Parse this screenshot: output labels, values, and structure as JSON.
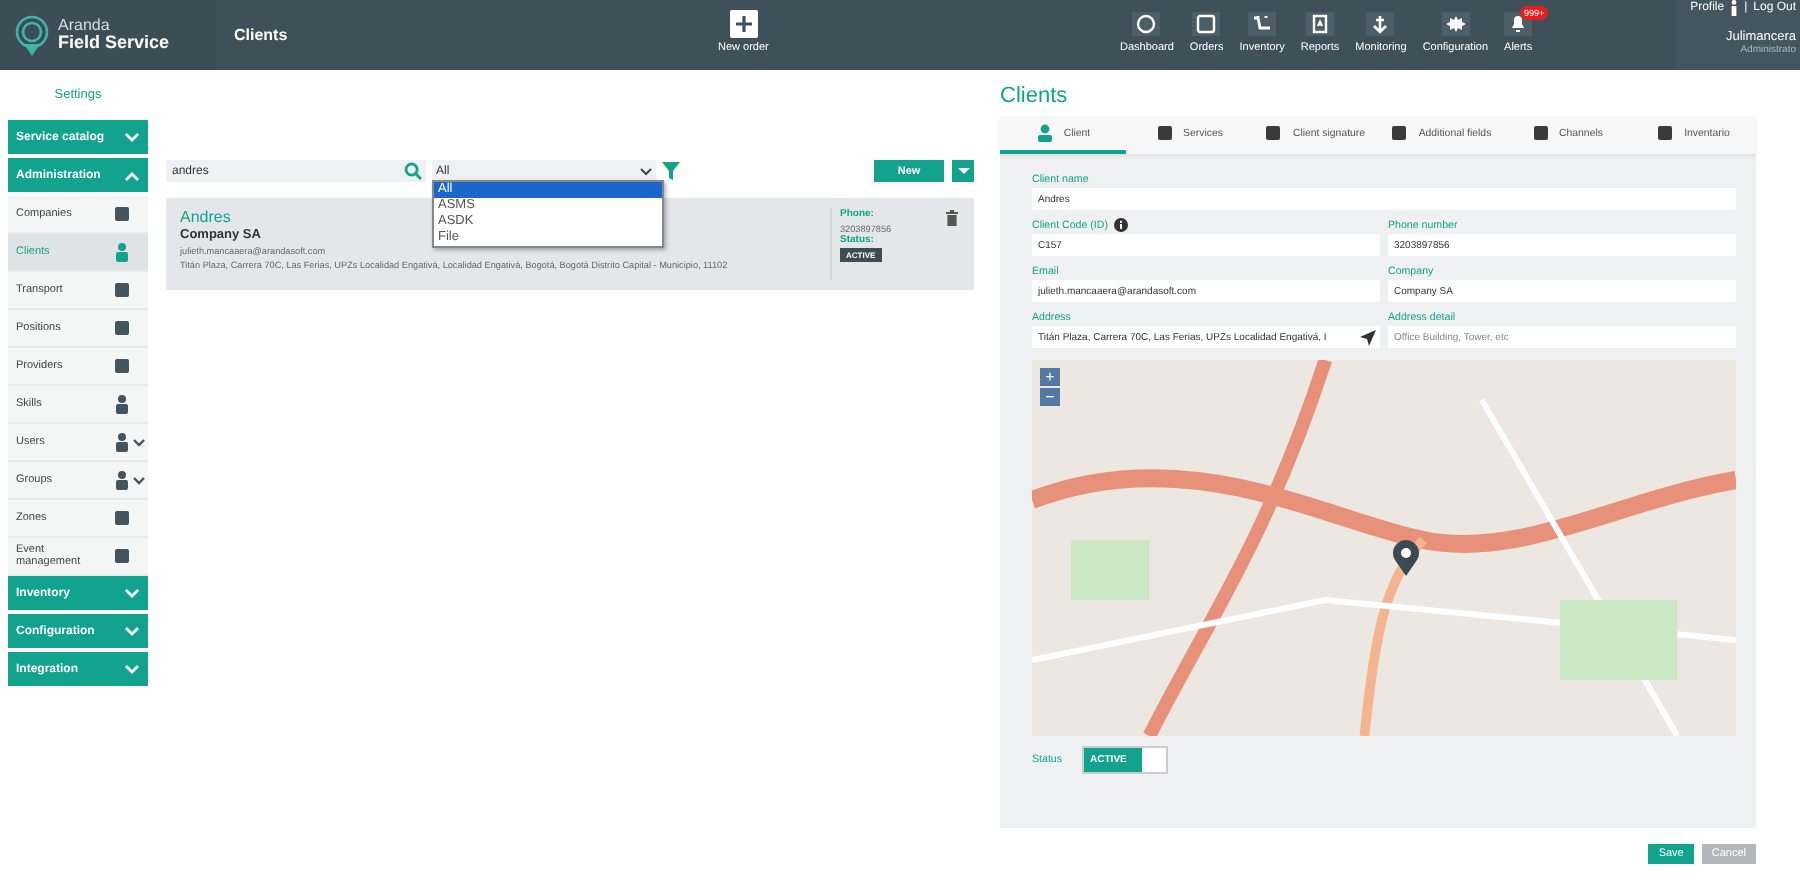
{
  "header": {
    "logo": [
      "Aranda",
      "Field Service"
    ],
    "page_title": "Clients",
    "new_order": "New order",
    "nav": [
      {
        "label": "Dashboard"
      },
      {
        "label": "Orders"
      },
      {
        "label": "Inventory"
      },
      {
        "label": "Reports"
      },
      {
        "label": "Monitoring"
      },
      {
        "label": "Configuration"
      },
      {
        "label": "Alerts",
        "badge": "999+"
      }
    ],
    "profile": "Profile",
    "separator": "|",
    "logout": "Log Out",
    "user": "Julimancera",
    "role": "Administrato"
  },
  "sidebar": {
    "title": "Settings",
    "sections": [
      {
        "label": "Service catalog",
        "expanded": false
      },
      {
        "label": "Administration",
        "expanded": true,
        "children": [
          {
            "label": "Companies",
            "selected": false,
            "kind": "link"
          },
          {
            "label": "Clients",
            "selected": true,
            "kind": "link"
          },
          {
            "label": "Transport",
            "selected": false,
            "kind": "link"
          },
          {
            "label": "Positions",
            "selected": false,
            "kind": "link"
          },
          {
            "label": "Providers",
            "selected": false,
            "kind": "link"
          },
          {
            "label": "Skills",
            "selected": false,
            "kind": "link"
          },
          {
            "label": "Users",
            "selected": false,
            "kind": "submenu"
          },
          {
            "label": "Groups",
            "selected": false,
            "kind": "submenu"
          },
          {
            "label": "Zones",
            "selected": false,
            "kind": "link"
          },
          {
            "label": "Event management",
            "selected": false,
            "kind": "link"
          }
        ]
      },
      {
        "label": "Inventory",
        "expanded": false
      },
      {
        "label": "Configuration",
        "expanded": false
      },
      {
        "label": "Integration",
        "expanded": false
      }
    ]
  },
  "filters": {
    "search": "andres",
    "select": "All",
    "options": [
      {
        "label": "All",
        "selected": true
      },
      {
        "label": "ASMS",
        "selected": false
      },
      {
        "label": "ASDK",
        "selected": false
      },
      {
        "label": "File",
        "selected": false
      }
    ],
    "new_button": "New"
  },
  "card": {
    "name": "Andres",
    "company": "Company SA",
    "email": "julieth.mancaaera@arandasoft.com",
    "address": "Titán Plaza, Carrera 70C, Las Ferias, UPZs Localidad Engativá, Localidad Engativá, Bogotá, Bogotá Distrito Capital - Municipio, 11102",
    "phone_label": "Phone:",
    "phone": "3203897856",
    "status_label": "Status:",
    "status": "ACTIVE"
  },
  "detail": {
    "title": "Clients",
    "tabs": [
      {
        "label": "Client",
        "selected": true
      },
      {
        "label": "Services",
        "selected": false
      },
      {
        "label": "Client signature",
        "selected": false
      },
      {
        "label": "Additional fields",
        "selected": false
      },
      {
        "label": "Channels",
        "selected": false
      },
      {
        "label": "Inventario",
        "selected": false
      }
    ],
    "rows": [
      {
        "fields": [
          {
            "label": "Client name",
            "value": "Andres",
            "kind": "plain"
          }
        ]
      },
      {
        "fields": [
          {
            "label": "Client Code (ID)",
            "value": "C157",
            "kind": "info"
          },
          {
            "label": "Phone number",
            "value": "3203897856",
            "kind": "plain"
          }
        ]
      },
      {
        "fields": [
          {
            "label": "Email",
            "value": "julieth.mancaaera@arandasoft.com",
            "kind": "plain"
          },
          {
            "label": "Company",
            "value": "Company SA",
            "kind": "plain"
          }
        ]
      },
      {
        "fields": [
          {
            "label": "Address",
            "value": "Titán Plaza, Carrera 70C, Las Ferias, UPZs Localidad Engativá, I",
            "kind": "locate"
          },
          {
            "label": "Address detail",
            "placeholder": "Office Building, Tower, etc",
            "kind": "plain"
          }
        ]
      }
    ],
    "map": {
      "zoom_in": "+",
      "zoom_out": "−"
    },
    "status_label": "Status",
    "status": {
      "label": "ACTIVE",
      "on": true
    },
    "buttons": [
      {
        "label": "Save",
        "kind": "primary"
      },
      {
        "label": "Cancel",
        "kind": "secondary"
      }
    ]
  }
}
